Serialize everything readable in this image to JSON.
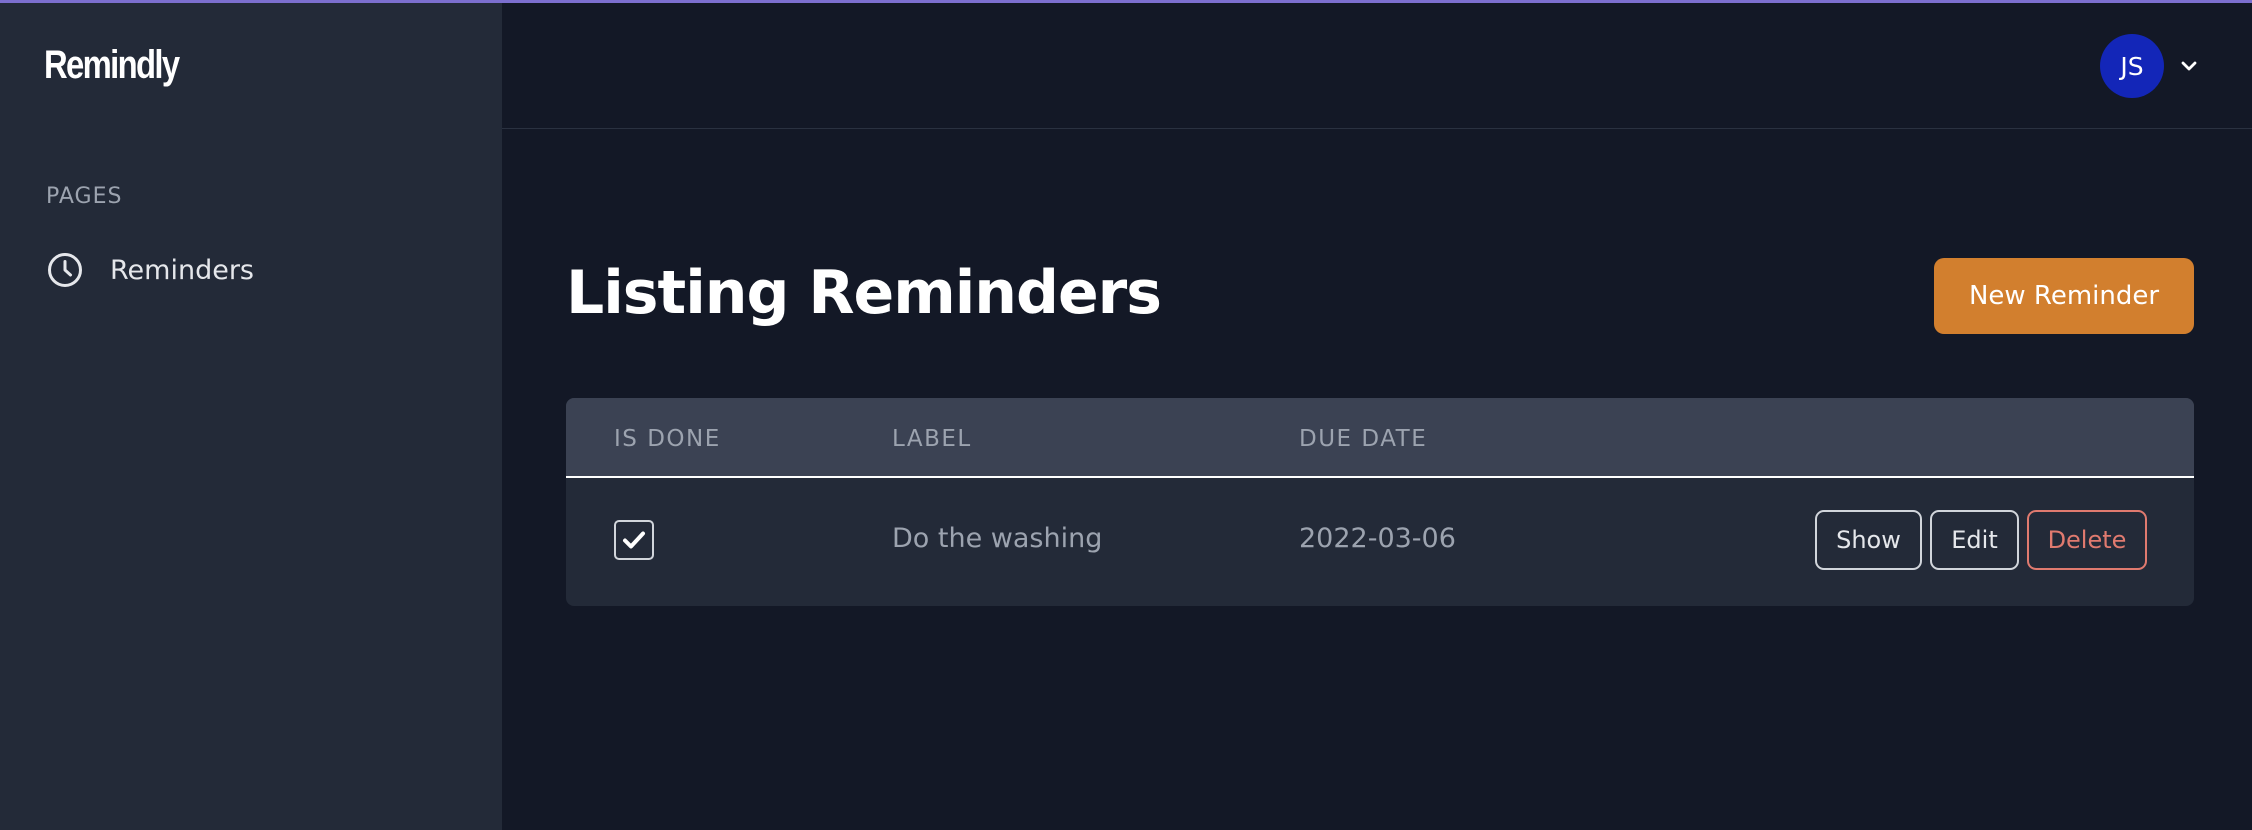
{
  "app": {
    "name": "Remindly"
  },
  "sidebar": {
    "section_label": "PAGES",
    "items": [
      {
        "label": "Reminders",
        "icon": "clock-icon"
      }
    ]
  },
  "header": {
    "user_initials": "JS",
    "avatar_color": "#1326b8"
  },
  "main": {
    "title": "Listing Reminders",
    "new_button_label": "New Reminder",
    "accent_color": "#d27f2e",
    "table": {
      "columns": [
        "IS DONE",
        "LABEL",
        "DUE DATE"
      ],
      "rows": [
        {
          "is_done": true,
          "label": "Do the washing",
          "due_date": "2022-03-06",
          "actions": [
            "Show",
            "Edit",
            "Delete"
          ]
        }
      ]
    }
  }
}
